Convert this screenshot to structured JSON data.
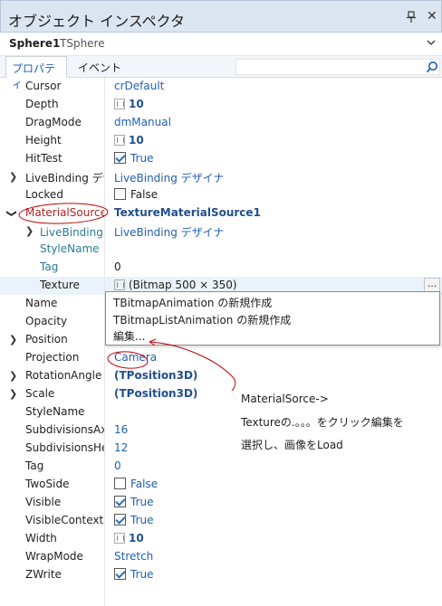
{
  "window": {
    "title": "オブジェクト インスペクタ"
  },
  "object": {
    "name": "Sphere1",
    "type": "TSphere"
  },
  "tabs": {
    "properties": "プロパティ",
    "events": "イベント"
  },
  "properties": [
    {
      "name": "Cursor",
      "value": "crDefault"
    },
    {
      "name": "Depth",
      "value": "10"
    },
    {
      "name": "DragMode",
      "value": "dmManual"
    },
    {
      "name": "Height",
      "value": "10"
    },
    {
      "name": "HitTest",
      "value": "True"
    },
    {
      "name": "LiveBinding デザ",
      "value": "LiveBinding デザイナ"
    },
    {
      "name": "Locked",
      "value": "False"
    },
    {
      "name": "MaterialSource",
      "value": "TextureMaterialSource1"
    },
    {
      "name": "LiveBinding デ",
      "value": "LiveBinding デザイナ"
    },
    {
      "name": "StyleName",
      "value": ""
    },
    {
      "name": "Tag",
      "value": "0"
    },
    {
      "name": "Texture",
      "value": "(Bitmap 500 × 350)"
    },
    {
      "name": "Name",
      "value": ""
    },
    {
      "name": "Opacity",
      "value": ""
    },
    {
      "name": "Position",
      "value": ""
    },
    {
      "name": "Projection",
      "value": "Camera"
    },
    {
      "name": "RotationAngle",
      "value": "(TPosition3D)"
    },
    {
      "name": "Scale",
      "value": "(TPosition3D)"
    },
    {
      "name": "StyleName",
      "value": ""
    },
    {
      "name": "SubdivisionsAxes",
      "value": "16"
    },
    {
      "name": "SubdivisionsHeig",
      "value": "12"
    },
    {
      "name": "Tag",
      "value": "0"
    },
    {
      "name": "TwoSide",
      "value": "False"
    },
    {
      "name": "Visible",
      "value": "True"
    },
    {
      "name": "VisibleContextM",
      "value": "True"
    },
    {
      "name": "Width",
      "value": "10"
    },
    {
      "name": "WrapMode",
      "value": "Stretch"
    },
    {
      "name": "ZWrite",
      "value": "True"
    }
  ],
  "texture_menu": {
    "items": [
      "TBitmapAnimation の新規作成",
      "TBitmapListAnimation の新規作成",
      "編集..."
    ]
  },
  "ellipsis_label": "...",
  "annotation": {
    "line1": "MaterialSorce->",
    "line2": "Textureの.。。。をクリック編集を",
    "line3": "選択し、画像をLoad"
  },
  "colors": {
    "accent": "#1f5fb0",
    "annotation": "#c00000",
    "selected_row": "#eaf3fb"
  },
  "icons": {
    "pin": "pin-icon",
    "close": "close-icon",
    "search": "search-icon",
    "dropdown": "chevron-down-icon"
  }
}
